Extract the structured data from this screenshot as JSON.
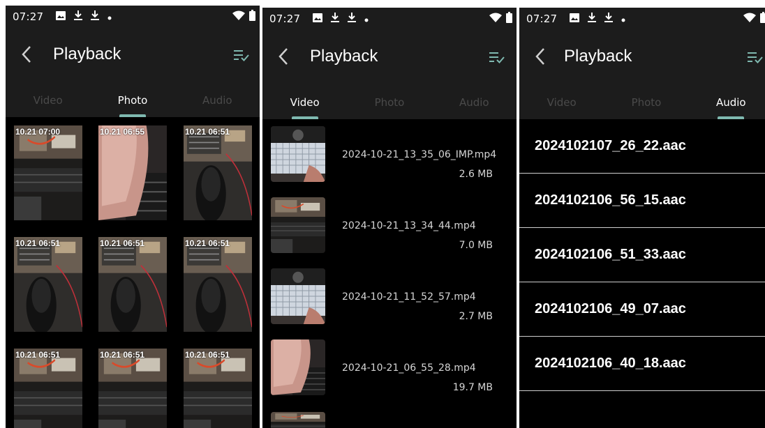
{
  "status": {
    "time": "07:27"
  },
  "screens": {
    "photo": {
      "title": "Playback",
      "tabs": [
        "Video",
        "Photo",
        "Audio"
      ],
      "active_tab": 1,
      "photos": [
        {
          "stamp": "10.21 07:00",
          "theme": "desk"
        },
        {
          "stamp": "10.21 06:55",
          "theme": "finger"
        },
        {
          "stamp": "10.21 06:51",
          "theme": "mouse"
        },
        {
          "stamp": "10.21 06:51",
          "theme": "mouse"
        },
        {
          "stamp": "10.21 06:51",
          "theme": "mouse"
        },
        {
          "stamp": "10.21 06:51",
          "theme": "mouse"
        },
        {
          "stamp": "10.21 06:51",
          "theme": "desk"
        },
        {
          "stamp": "10.21 06:51",
          "theme": "desk"
        },
        {
          "stamp": "10.21 06:51",
          "theme": "desk"
        }
      ]
    },
    "video": {
      "title": "Playback",
      "tabs": [
        "Video",
        "Photo",
        "Audio"
      ],
      "active_tab": 0,
      "videos": [
        {
          "name": "2024-10-21_13_35_06_IMP.mp4",
          "size": "2.6 MB",
          "theme": "keyboard"
        },
        {
          "name": "2024-10-21_13_34_44.mp4",
          "size": "7.0 MB",
          "theme": "desk"
        },
        {
          "name": "2024-10-21_11_52_57.mp4",
          "size": "2.7 MB",
          "theme": "keyboard"
        },
        {
          "name": "2024-10-21_06_55_28.mp4",
          "size": "19.7 MB",
          "theme": "finger"
        }
      ]
    },
    "audio": {
      "title": "Playback",
      "tabs": [
        "Video",
        "Photo",
        "Audio"
      ],
      "active_tab": 2,
      "files": [
        "2024102107_26_22.aac",
        "2024102106_56_15.aac",
        "2024102106_51_33.aac",
        "2024102106_49_07.aac",
        "2024102106_40_18.aac"
      ]
    }
  },
  "icons": {
    "status_left": [
      "image-icon",
      "download-icon",
      "download-icon",
      "dot-icon"
    ],
    "status_right": [
      "wifi-icon",
      "battery-icon"
    ],
    "back": "chevron-left-icon",
    "select": "select-list-icon"
  },
  "colors": {
    "bar": "#1c1c1c",
    "accent": "#7fb9b0",
    "inactive_tab": "#4a4a4a"
  }
}
